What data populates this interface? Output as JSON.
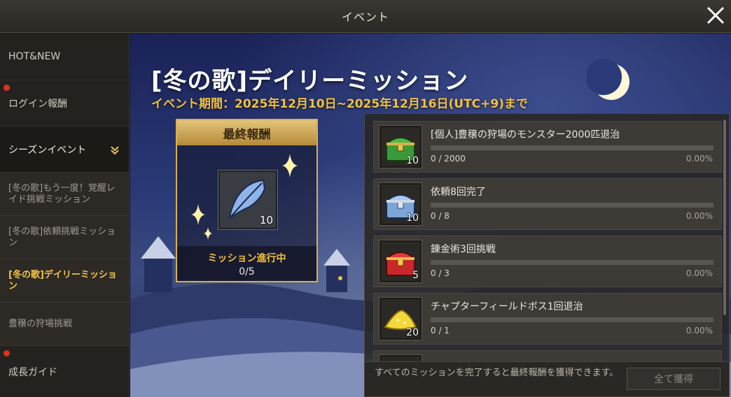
{
  "window": {
    "title": "イベント"
  },
  "sidebar": {
    "items": [
      {
        "label": "HOT&NEW",
        "dot": false
      },
      {
        "label": "ログイン報酬",
        "dot": true
      },
      {
        "label": "シーズンイベント",
        "dot": false
      }
    ],
    "sub_items": [
      {
        "label": "[冬の歌]もう一度！覚醒レイド挑戦ミッション",
        "active": false
      },
      {
        "label": "[冬の歌]依頼挑戦ミッション",
        "active": false
      },
      {
        "label": "[冬の歌]デイリーミッション",
        "active": true
      },
      {
        "label": "豊穣の狩場挑戦",
        "active": false
      }
    ],
    "bottom_item": {
      "label": "成長ガイド",
      "dot": true
    }
  },
  "event": {
    "title": "[冬の歌]デイリーミッション",
    "period": "イベント期間：2025年12月10日~2025年12月16日(UTC+9)まで"
  },
  "final_reward": {
    "header": "最終報酬",
    "item_icon": "feather-icon",
    "item_count": "10",
    "status": "ミッション進行中",
    "progress": "0/5"
  },
  "missions": [
    {
      "name": "[個人]豊穣の狩場のモンスター2000匹退治",
      "progress": "0 / 2000",
      "percent": "0.00%",
      "fill": 0,
      "reward_icon": "green-chest-icon",
      "reward_count": "10"
    },
    {
      "name": "依頼8回完了",
      "progress": "0 / 8",
      "percent": "0.00%",
      "fill": 0,
      "reward_icon": "blue-chest-icon",
      "reward_count": "10"
    },
    {
      "name": "錬金術3回挑戦",
      "progress": "0 / 3",
      "percent": "0.00%",
      "fill": 0,
      "reward_icon": "red-chest-icon",
      "reward_count": "5"
    },
    {
      "name": "チャプターフィールドボス1回退治",
      "progress": "0 / 1",
      "percent": "0.00%",
      "fill": 0,
      "reward_icon": "gold-dust-icon",
      "reward_count": "20"
    }
  ],
  "footer": {
    "note": "すべてのミッションを完了すると最終報酬を獲得できます。",
    "claim_all_label": "全て獲得"
  },
  "colors": {
    "accent_gold": "#f1c13e",
    "notification_dot": "#e0301e"
  }
}
